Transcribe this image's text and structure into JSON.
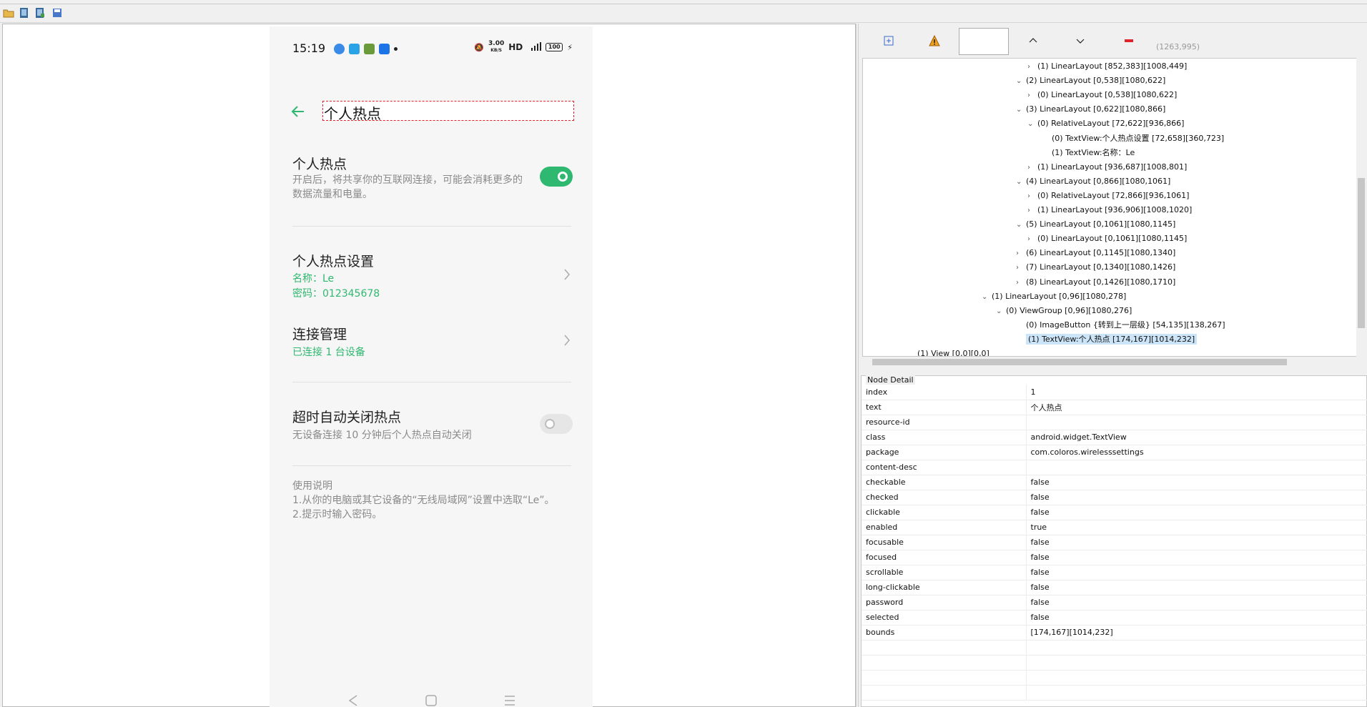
{
  "phone": {
    "time": "15:19",
    "speed_value": "3.00",
    "speed_unit": "KB/S",
    "hd": "HD",
    "signal": "⁴ᴳ",
    "battery": "100",
    "page_title": "个人热点",
    "hotspot": {
      "title": "个人热点",
      "subtitle": "开启后，将共享你的互联网连接，可能会消耗更多的数据流量和电量。",
      "enabled": true
    },
    "settings": {
      "title": "个人热点设置",
      "name": "名称：Le",
      "password": "密码：012345678"
    },
    "connections": {
      "title": "连接管理",
      "status": "已连接 1 台设备"
    },
    "auto_off": {
      "title": "超时自动关闭热点",
      "subtitle": "无设备连接 10 分钟后个人热点自动关闭",
      "enabled": false
    },
    "instructions": {
      "title": "使用说明",
      "line1": "1.从你的电脑或其它设备的“无线局域网”设置中选取“Le”。",
      "line2": "2.提示时输入密码。"
    }
  },
  "toolbar": {
    "coordinates": "(1263,995)"
  },
  "tree": [
    {
      "arrow": ">",
      "label": "(1) LinearLayout [852,383][1008,449]"
    },
    {
      "arrow": "v",
      "label": "(2) LinearLayout [0,538][1080,622]"
    },
    {
      "arrow": ">",
      "label": "(0) LinearLayout [0,538][1080,622]"
    },
    {
      "arrow": "v",
      "label": "(3) LinearLayout [0,622][1080,866]"
    },
    {
      "arrow": "v",
      "label": "(0) RelativeLayout [72,622][936,866]"
    },
    {
      "arrow": "",
      "label": "(0) TextView:个人热点设置 [72,658][360,723]"
    },
    {
      "arrow": "",
      "label": "(1) TextView:名称：Le"
    },
    {
      "arrow": ">",
      "label": "(1) LinearLayout [936,687][1008,801]"
    },
    {
      "arrow": "v",
      "label": "(4) LinearLayout [0,866][1080,1061]"
    },
    {
      "arrow": ">",
      "label": "(0) RelativeLayout [72,866][936,1061]"
    },
    {
      "arrow": ">",
      "label": "(1) LinearLayout [936,906][1008,1020]"
    },
    {
      "arrow": "v",
      "label": "(5) LinearLayout [0,1061][1080,1145]"
    },
    {
      "arrow": ">",
      "label": "(0) LinearLayout [0,1061][1080,1145]"
    },
    {
      "arrow": ">",
      "label": "(6) LinearLayout [0,1145][1080,1340]"
    },
    {
      "arrow": ">",
      "label": "(7) LinearLayout [0,1340][1080,1426]"
    },
    {
      "arrow": ">",
      "label": "(8) LinearLayout [0,1426][1080,1710]"
    },
    {
      "arrow": "v",
      "label": "(1) LinearLayout [0,96][1080,278]"
    },
    {
      "arrow": "v",
      "label": "(0) ViewGroup [0,96][1080,276]"
    },
    {
      "arrow": "",
      "label": "(0) ImageButton {转到上一层级} [54,135][138,267]"
    },
    {
      "arrow": "",
      "label": "(1) TextView:个人热点 [174,167][1014,232]",
      "selected": true
    },
    {
      "arrow": "",
      "label": "(1) View [0,0][0,0]"
    }
  ],
  "detail": {
    "title": "Node Detail",
    "rows": [
      {
        "key": "index",
        "value": "1"
      },
      {
        "key": "text",
        "value": "个人热点"
      },
      {
        "key": "resource-id",
        "value": ""
      },
      {
        "key": "class",
        "value": "android.widget.TextView"
      },
      {
        "key": "package",
        "value": "com.coloros.wirelesssettings"
      },
      {
        "key": "content-desc",
        "value": ""
      },
      {
        "key": "checkable",
        "value": "false"
      },
      {
        "key": "checked",
        "value": "false"
      },
      {
        "key": "clickable",
        "value": "false"
      },
      {
        "key": "enabled",
        "value": "true"
      },
      {
        "key": "focusable",
        "value": "false"
      },
      {
        "key": "focused",
        "value": "false"
      },
      {
        "key": "scrollable",
        "value": "false"
      },
      {
        "key": "long-clickable",
        "value": "false"
      },
      {
        "key": "password",
        "value": "false"
      },
      {
        "key": "selected",
        "value": "false"
      },
      {
        "key": "bounds",
        "value": "[174,167][1014,232]"
      },
      {
        "key": "",
        "value": ""
      },
      {
        "key": "",
        "value": ""
      },
      {
        "key": "",
        "value": ""
      },
      {
        "key": "",
        "value": ""
      }
    ]
  }
}
